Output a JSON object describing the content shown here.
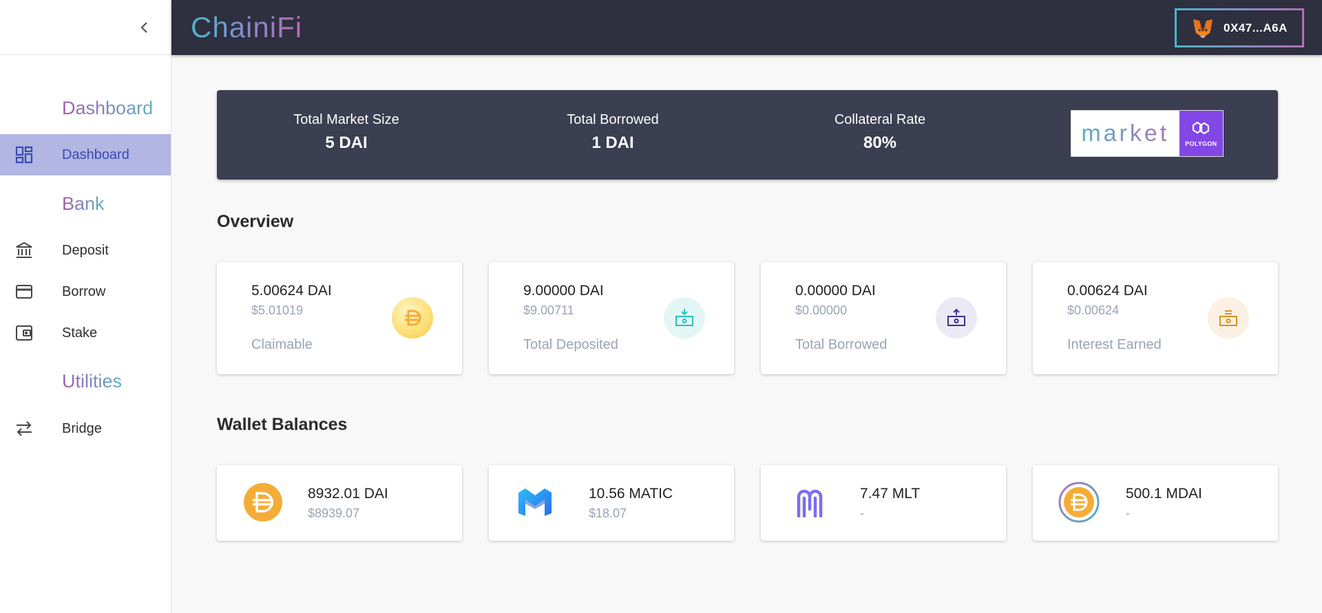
{
  "brand": "ChainiFi",
  "wallet": {
    "address": "0X47...A6A",
    "icon": "metamask-fox-icon"
  },
  "sidebar": {
    "sections": [
      {
        "title": "Dashboard"
      },
      {
        "title": "Bank"
      },
      {
        "title": "Utilities"
      }
    ],
    "items": [
      {
        "label": "Dashboard",
        "icon": "dashboard-icon",
        "active": true
      },
      {
        "label": "Deposit",
        "icon": "bank-icon"
      },
      {
        "label": "Borrow",
        "icon": "credit-card-icon"
      },
      {
        "label": "Stake",
        "icon": "wallet-icon"
      },
      {
        "label": "Bridge",
        "icon": "swap-arrows-icon"
      }
    ]
  },
  "stats": [
    {
      "label": "Total Market Size",
      "value": "5 DAI"
    },
    {
      "label": "Total Borrowed",
      "value": "1 DAI"
    },
    {
      "label": "Collateral Rate",
      "value": "80%"
    }
  ],
  "market_logo": {
    "text": "market",
    "badge": "POLYGON"
  },
  "overview": {
    "title": "Overview",
    "cards": [
      {
        "amount": "5.00624 DAI",
        "usd": "$5.01019",
        "caption": "Claimable",
        "icon": "dai-coin-icon"
      },
      {
        "amount": "9.00000 DAI",
        "usd": "$9.00711",
        "caption": "Total Deposited",
        "icon": "cash-deposit-icon"
      },
      {
        "amount": "0.00000 DAI",
        "usd": "$0.00000",
        "caption": "Total Borrowed",
        "icon": "cash-withdraw-icon"
      },
      {
        "amount": "0.00624 DAI",
        "usd": "$0.00624",
        "caption": "Interest Earned",
        "icon": "cash-interest-icon"
      }
    ]
  },
  "wallet_balances": {
    "title": "Wallet Balances",
    "cards": [
      {
        "amount": "8932.01 DAI",
        "sub": "$8939.07",
        "icon": "dai-logo-icon"
      },
      {
        "amount": "10.56 MATIC",
        "sub": "$18.07",
        "icon": "matic-logo-icon"
      },
      {
        "amount": "7.47 MLT",
        "sub": "-",
        "icon": "mlt-logo-icon"
      },
      {
        "amount": "500.1 MDAI",
        "sub": "-",
        "icon": "mdai-logo-icon"
      }
    ]
  },
  "colors": {
    "header_bg": "#2e2f3f",
    "banner_bg": "#3c3e51",
    "active_nav_bg": "#b1b6e3",
    "dai_yellow": "#f5ac37",
    "polygon_purple": "#8247e5"
  }
}
